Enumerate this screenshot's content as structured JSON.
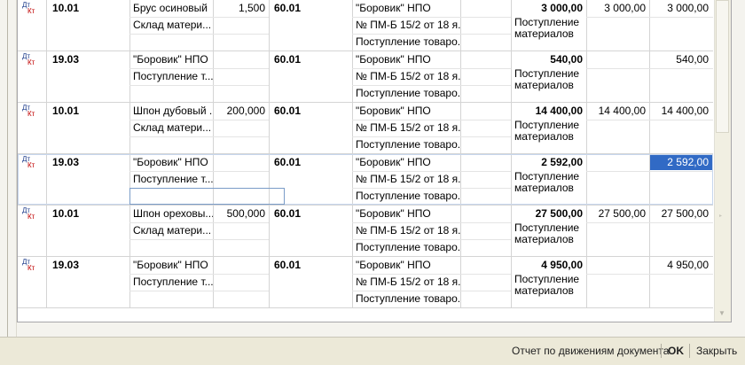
{
  "entries": [
    {
      "dt": "Дт",
      "kt": "Кт",
      "debit_account": "10.01",
      "subconto1": "Брус осиновый",
      "subconto2": "Склад матери...",
      "quantity": "1,500",
      "credit_account": "60.01",
      "credit_sub1": "\"Боровик\" НПО",
      "credit_sub2": "№ ПМ-Б 15/2 от 18 я...",
      "credit_sub3": "Поступление товаро...",
      "amount": "3 000,00",
      "content": "Поступление материалов",
      "amount_nu": "3 000,00",
      "amount_total": "3 000,00"
    },
    {
      "dt": "Дт",
      "kt": "Кт",
      "debit_account": "19.03",
      "subconto1": "\"Боровик\" НПО",
      "subconto2": "Поступление т...",
      "quantity": "",
      "credit_account": "60.01",
      "credit_sub1": "\"Боровик\" НПО",
      "credit_sub2": "№ ПМ-Б 15/2 от 18 я...",
      "credit_sub3": "Поступление товаро...",
      "amount": "540,00",
      "content": "Поступление материалов",
      "amount_nu": "",
      "amount_total": "540,00"
    },
    {
      "dt": "Дт",
      "kt": "Кт",
      "debit_account": "10.01",
      "subconto1": "Шпон дубовый ...",
      "subconto2": "Склад матери...",
      "quantity": "200,000",
      "credit_account": "60.01",
      "credit_sub1": "\"Боровик\" НПО",
      "credit_sub2": "№ ПМ-Б 15/2 от 18 я...",
      "credit_sub3": "Поступление товаро...",
      "amount": "14 400,00",
      "content": "Поступление материалов",
      "amount_nu": "14 400,00",
      "amount_total": "14 400,00"
    },
    {
      "dt": "Дт",
      "kt": "Кт",
      "debit_account": "19.03",
      "subconto1": "\"Боровик\" НПО",
      "subconto2": "Поступление т...",
      "quantity": "",
      "credit_account": "60.01",
      "credit_sub1": "\"Боровик\" НПО",
      "credit_sub2": "№ ПМ-Б 15/2 от 18 я...",
      "credit_sub3": "Поступление товаро...",
      "amount": "2 592,00",
      "content": "Поступление материалов",
      "amount_nu": "",
      "amount_total": "2 592,00"
    },
    {
      "dt": "Дт",
      "kt": "Кт",
      "debit_account": "10.01",
      "subconto1": "Шпон ореховы...",
      "subconto2": "Склад матери...",
      "quantity": "500,000",
      "credit_account": "60.01",
      "credit_sub1": "\"Боровик\" НПО",
      "credit_sub2": "№ ПМ-Б 15/2 от 18 я...",
      "credit_sub3": "Поступление товаро...",
      "amount": "27 500,00",
      "content": "Поступление материалов",
      "amount_nu": "27 500,00",
      "amount_total": "27 500,00"
    },
    {
      "dt": "Дт",
      "kt": "Кт",
      "debit_account": "19.03",
      "subconto1": "\"Боровик\" НПО",
      "subconto2": "Поступление т...",
      "quantity": "",
      "credit_account": "60.01",
      "credit_sub1": "\"Боровик\" НПО",
      "credit_sub2": "№ ПМ-Б 15/2 от 18 я...",
      "credit_sub3": "Поступление товаро...",
      "amount": "4 950,00",
      "content": "Поступление материалов",
      "amount_nu": "",
      "amount_total": "4 950,00"
    }
  ],
  "footer": {
    "report_label": "Отчет по движениям документа",
    "ok_label": "OK",
    "close_label": "Закрыть"
  },
  "icons": {
    "entry_type": "dt-kt-entry-icon",
    "scroll_down": "scroll-down-arrow-icon"
  },
  "colors": {
    "selection": "#316ac5",
    "grid_line": "#d4d4d4"
  }
}
